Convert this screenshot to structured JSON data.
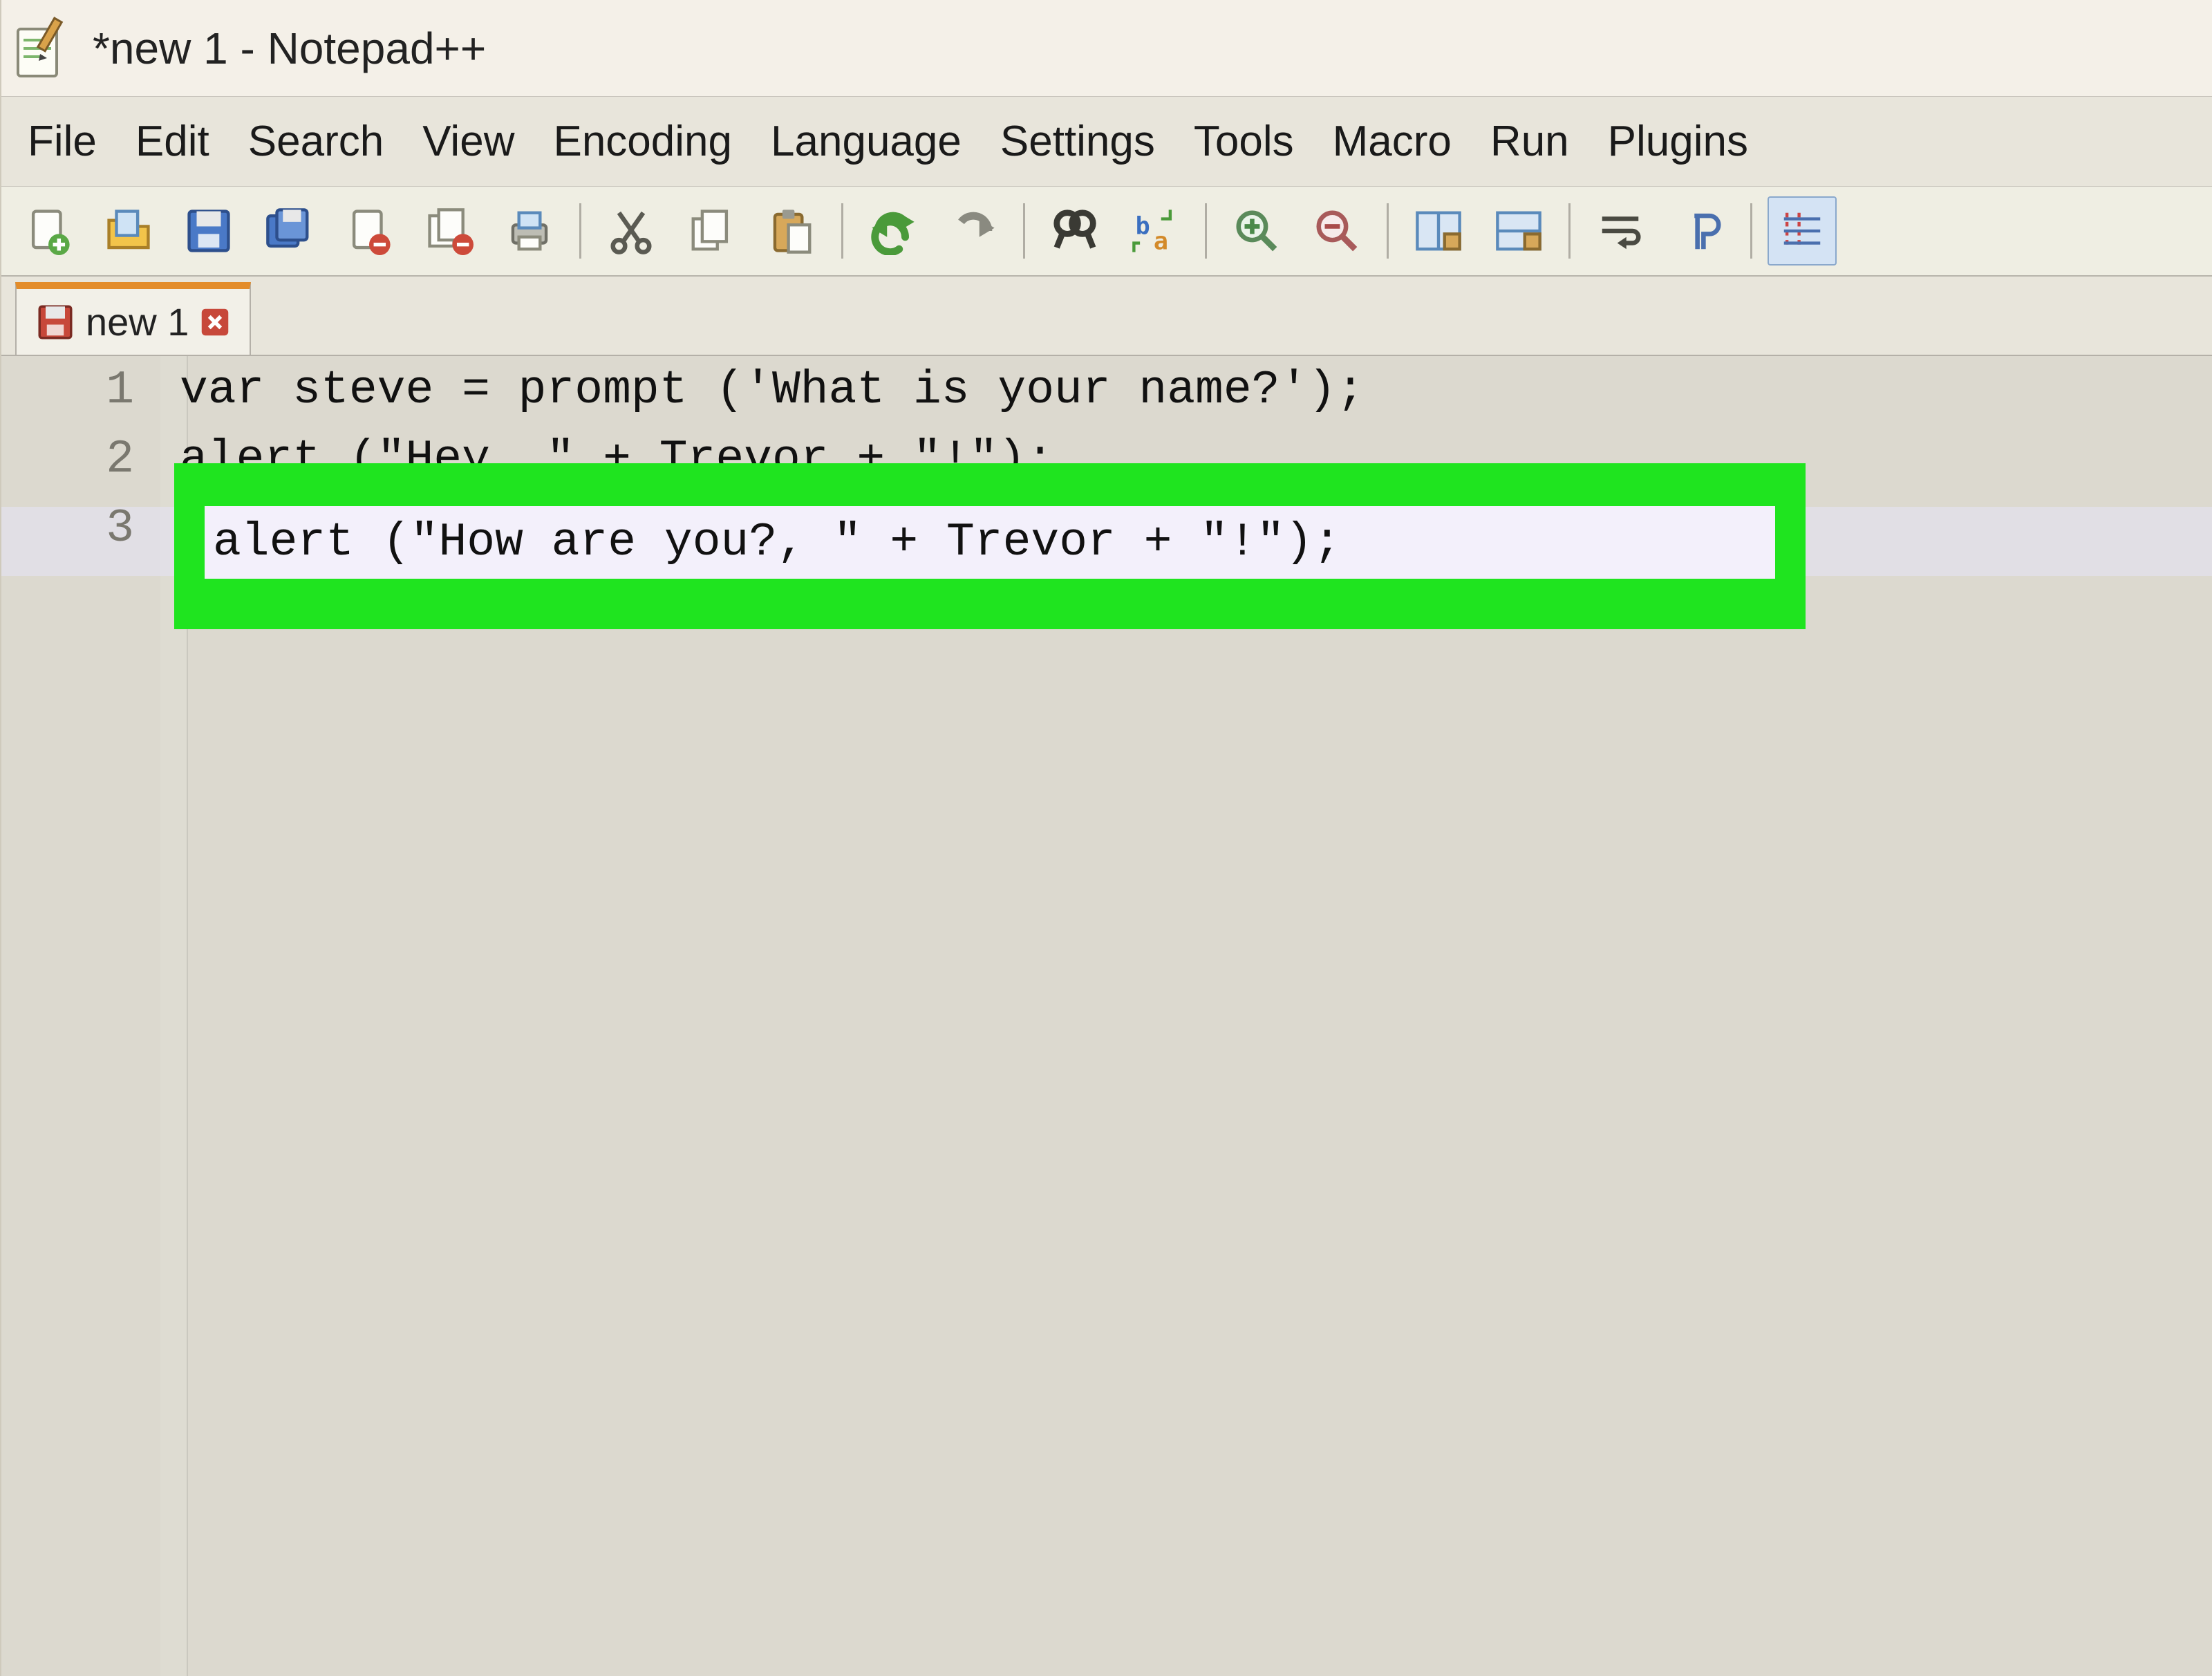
{
  "window": {
    "title": "*new 1 - Notepad++"
  },
  "menu": {
    "items": [
      "File",
      "Edit",
      "Search",
      "View",
      "Encoding",
      "Language",
      "Settings",
      "Tools",
      "Macro",
      "Run",
      "Plugins"
    ]
  },
  "toolbar": {
    "buttons": [
      {
        "name": "new-file",
        "group": 1
      },
      {
        "name": "open-file",
        "group": 1
      },
      {
        "name": "save-file",
        "group": 1
      },
      {
        "name": "save-all",
        "group": 1
      },
      {
        "name": "close-file",
        "group": 1
      },
      {
        "name": "close-all",
        "group": 1
      },
      {
        "name": "print",
        "group": 1
      },
      {
        "name": "cut",
        "group": 2
      },
      {
        "name": "copy",
        "group": 2
      },
      {
        "name": "paste",
        "group": 2
      },
      {
        "name": "undo",
        "group": 3
      },
      {
        "name": "redo",
        "group": 3
      },
      {
        "name": "find",
        "group": 4
      },
      {
        "name": "find-replace",
        "group": 4
      },
      {
        "name": "zoom-in",
        "group": 5
      },
      {
        "name": "zoom-out",
        "group": 5
      },
      {
        "name": "sync-v",
        "group": 6
      },
      {
        "name": "sync-h",
        "group": 6
      },
      {
        "name": "word-wrap",
        "group": 7
      },
      {
        "name": "show-all",
        "group": 7
      },
      {
        "name": "indent-guide",
        "group": 8
      }
    ]
  },
  "tabs": {
    "active": {
      "label": "new 1",
      "dirty": true
    }
  },
  "editor": {
    "lines": [
      {
        "n": "1",
        "text": "var steve = prompt ('What is your name?');"
      },
      {
        "n": "2",
        "text": "alert (\"Hey, \" + Trevor + \"!\");"
      },
      {
        "n": "3",
        "text": "alert (\"How are you?, \" + Trevor + \"!\");"
      }
    ],
    "highlighted_line_index": 2,
    "highlighted_text": "alert (\"How are you?, \" + Trevor + \"!\");"
  },
  "colors": {
    "highlight_green": "#1fe41f",
    "tab_active_accent": "#e38c2a",
    "current_line": "#e5e2f4"
  }
}
